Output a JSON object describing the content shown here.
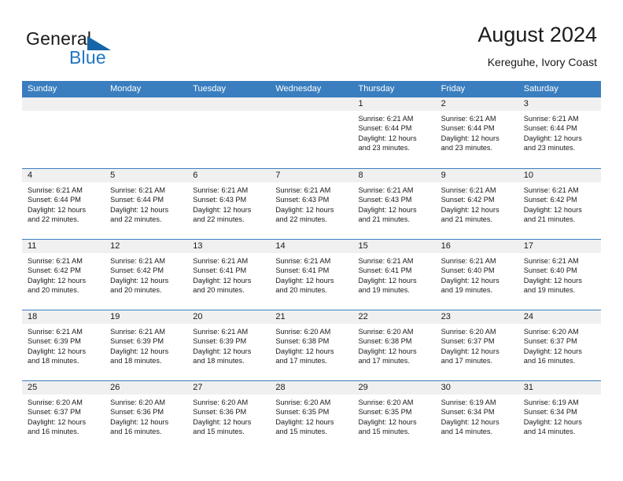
{
  "brand": {
    "name_part1": "General",
    "name_part2": "Blue",
    "triangle_color": "#1565a8",
    "blue_color": "#1f76c2"
  },
  "header": {
    "title": "August 2024",
    "subtitle": "Kereguhe, Ivory Coast"
  },
  "theme": {
    "header_bar": "#3a7ebf",
    "day_band": "#f0f0f0",
    "row_divider": "#3a7ebf",
    "text": "#1a1a1a"
  },
  "weekdays": [
    "Sunday",
    "Monday",
    "Tuesday",
    "Wednesday",
    "Thursday",
    "Friday",
    "Saturday"
  ],
  "labels": {
    "sunrise_prefix": "Sunrise: ",
    "sunset_prefix": "Sunset: ",
    "daylight_prefix": "Daylight: "
  },
  "weeks": [
    [
      {
        "day": "",
        "empty": true,
        "sunrise": "",
        "sunset": "",
        "daylight_line1": "",
        "daylight_line2": ""
      },
      {
        "day": "",
        "empty": true,
        "sunrise": "",
        "sunset": "",
        "daylight_line1": "",
        "daylight_line2": ""
      },
      {
        "day": "",
        "empty": true,
        "sunrise": "",
        "sunset": "",
        "daylight_line1": "",
        "daylight_line2": ""
      },
      {
        "day": "",
        "empty": true,
        "sunrise": "",
        "sunset": "",
        "daylight_line1": "",
        "daylight_line2": ""
      },
      {
        "day": "1",
        "empty": false,
        "sunrise": "Sunrise: 6:21 AM",
        "sunset": "Sunset: 6:44 PM",
        "daylight_line1": "Daylight: 12 hours",
        "daylight_line2": "and 23 minutes."
      },
      {
        "day": "2",
        "empty": false,
        "sunrise": "Sunrise: 6:21 AM",
        "sunset": "Sunset: 6:44 PM",
        "daylight_line1": "Daylight: 12 hours",
        "daylight_line2": "and 23 minutes."
      },
      {
        "day": "3",
        "empty": false,
        "sunrise": "Sunrise: 6:21 AM",
        "sunset": "Sunset: 6:44 PM",
        "daylight_line1": "Daylight: 12 hours",
        "daylight_line2": "and 23 minutes."
      }
    ],
    [
      {
        "day": "4",
        "empty": false,
        "sunrise": "Sunrise: 6:21 AM",
        "sunset": "Sunset: 6:44 PM",
        "daylight_line1": "Daylight: 12 hours",
        "daylight_line2": "and 22 minutes."
      },
      {
        "day": "5",
        "empty": false,
        "sunrise": "Sunrise: 6:21 AM",
        "sunset": "Sunset: 6:44 PM",
        "daylight_line1": "Daylight: 12 hours",
        "daylight_line2": "and 22 minutes."
      },
      {
        "day": "6",
        "empty": false,
        "sunrise": "Sunrise: 6:21 AM",
        "sunset": "Sunset: 6:43 PM",
        "daylight_line1": "Daylight: 12 hours",
        "daylight_line2": "and 22 minutes."
      },
      {
        "day": "7",
        "empty": false,
        "sunrise": "Sunrise: 6:21 AM",
        "sunset": "Sunset: 6:43 PM",
        "daylight_line1": "Daylight: 12 hours",
        "daylight_line2": "and 22 minutes."
      },
      {
        "day": "8",
        "empty": false,
        "sunrise": "Sunrise: 6:21 AM",
        "sunset": "Sunset: 6:43 PM",
        "daylight_line1": "Daylight: 12 hours",
        "daylight_line2": "and 21 minutes."
      },
      {
        "day": "9",
        "empty": false,
        "sunrise": "Sunrise: 6:21 AM",
        "sunset": "Sunset: 6:42 PM",
        "daylight_line1": "Daylight: 12 hours",
        "daylight_line2": "and 21 minutes."
      },
      {
        "day": "10",
        "empty": false,
        "sunrise": "Sunrise: 6:21 AM",
        "sunset": "Sunset: 6:42 PM",
        "daylight_line1": "Daylight: 12 hours",
        "daylight_line2": "and 21 minutes."
      }
    ],
    [
      {
        "day": "11",
        "empty": false,
        "sunrise": "Sunrise: 6:21 AM",
        "sunset": "Sunset: 6:42 PM",
        "daylight_line1": "Daylight: 12 hours",
        "daylight_line2": "and 20 minutes."
      },
      {
        "day": "12",
        "empty": false,
        "sunrise": "Sunrise: 6:21 AM",
        "sunset": "Sunset: 6:42 PM",
        "daylight_line1": "Daylight: 12 hours",
        "daylight_line2": "and 20 minutes."
      },
      {
        "day": "13",
        "empty": false,
        "sunrise": "Sunrise: 6:21 AM",
        "sunset": "Sunset: 6:41 PM",
        "daylight_line1": "Daylight: 12 hours",
        "daylight_line2": "and 20 minutes."
      },
      {
        "day": "14",
        "empty": false,
        "sunrise": "Sunrise: 6:21 AM",
        "sunset": "Sunset: 6:41 PM",
        "daylight_line1": "Daylight: 12 hours",
        "daylight_line2": "and 20 minutes."
      },
      {
        "day": "15",
        "empty": false,
        "sunrise": "Sunrise: 6:21 AM",
        "sunset": "Sunset: 6:41 PM",
        "daylight_line1": "Daylight: 12 hours",
        "daylight_line2": "and 19 minutes."
      },
      {
        "day": "16",
        "empty": false,
        "sunrise": "Sunrise: 6:21 AM",
        "sunset": "Sunset: 6:40 PM",
        "daylight_line1": "Daylight: 12 hours",
        "daylight_line2": "and 19 minutes."
      },
      {
        "day": "17",
        "empty": false,
        "sunrise": "Sunrise: 6:21 AM",
        "sunset": "Sunset: 6:40 PM",
        "daylight_line1": "Daylight: 12 hours",
        "daylight_line2": "and 19 minutes."
      }
    ],
    [
      {
        "day": "18",
        "empty": false,
        "sunrise": "Sunrise: 6:21 AM",
        "sunset": "Sunset: 6:39 PM",
        "daylight_line1": "Daylight: 12 hours",
        "daylight_line2": "and 18 minutes."
      },
      {
        "day": "19",
        "empty": false,
        "sunrise": "Sunrise: 6:21 AM",
        "sunset": "Sunset: 6:39 PM",
        "daylight_line1": "Daylight: 12 hours",
        "daylight_line2": "and 18 minutes."
      },
      {
        "day": "20",
        "empty": false,
        "sunrise": "Sunrise: 6:21 AM",
        "sunset": "Sunset: 6:39 PM",
        "daylight_line1": "Daylight: 12 hours",
        "daylight_line2": "and 18 minutes."
      },
      {
        "day": "21",
        "empty": false,
        "sunrise": "Sunrise: 6:20 AM",
        "sunset": "Sunset: 6:38 PM",
        "daylight_line1": "Daylight: 12 hours",
        "daylight_line2": "and 17 minutes."
      },
      {
        "day": "22",
        "empty": false,
        "sunrise": "Sunrise: 6:20 AM",
        "sunset": "Sunset: 6:38 PM",
        "daylight_line1": "Daylight: 12 hours",
        "daylight_line2": "and 17 minutes."
      },
      {
        "day": "23",
        "empty": false,
        "sunrise": "Sunrise: 6:20 AM",
        "sunset": "Sunset: 6:37 PM",
        "daylight_line1": "Daylight: 12 hours",
        "daylight_line2": "and 17 minutes."
      },
      {
        "day": "24",
        "empty": false,
        "sunrise": "Sunrise: 6:20 AM",
        "sunset": "Sunset: 6:37 PM",
        "daylight_line1": "Daylight: 12 hours",
        "daylight_line2": "and 16 minutes."
      }
    ],
    [
      {
        "day": "25",
        "empty": false,
        "sunrise": "Sunrise: 6:20 AM",
        "sunset": "Sunset: 6:37 PM",
        "daylight_line1": "Daylight: 12 hours",
        "daylight_line2": "and 16 minutes."
      },
      {
        "day": "26",
        "empty": false,
        "sunrise": "Sunrise: 6:20 AM",
        "sunset": "Sunset: 6:36 PM",
        "daylight_line1": "Daylight: 12 hours",
        "daylight_line2": "and 16 minutes."
      },
      {
        "day": "27",
        "empty": false,
        "sunrise": "Sunrise: 6:20 AM",
        "sunset": "Sunset: 6:36 PM",
        "daylight_line1": "Daylight: 12 hours",
        "daylight_line2": "and 15 minutes."
      },
      {
        "day": "28",
        "empty": false,
        "sunrise": "Sunrise: 6:20 AM",
        "sunset": "Sunset: 6:35 PM",
        "daylight_line1": "Daylight: 12 hours",
        "daylight_line2": "and 15 minutes."
      },
      {
        "day": "29",
        "empty": false,
        "sunrise": "Sunrise: 6:20 AM",
        "sunset": "Sunset: 6:35 PM",
        "daylight_line1": "Daylight: 12 hours",
        "daylight_line2": "and 15 minutes."
      },
      {
        "day": "30",
        "empty": false,
        "sunrise": "Sunrise: 6:19 AM",
        "sunset": "Sunset: 6:34 PM",
        "daylight_line1": "Daylight: 12 hours",
        "daylight_line2": "and 14 minutes."
      },
      {
        "day": "31",
        "empty": false,
        "sunrise": "Sunrise: 6:19 AM",
        "sunset": "Sunset: 6:34 PM",
        "daylight_line1": "Daylight: 12 hours",
        "daylight_line2": "and 14 minutes."
      }
    ]
  ]
}
